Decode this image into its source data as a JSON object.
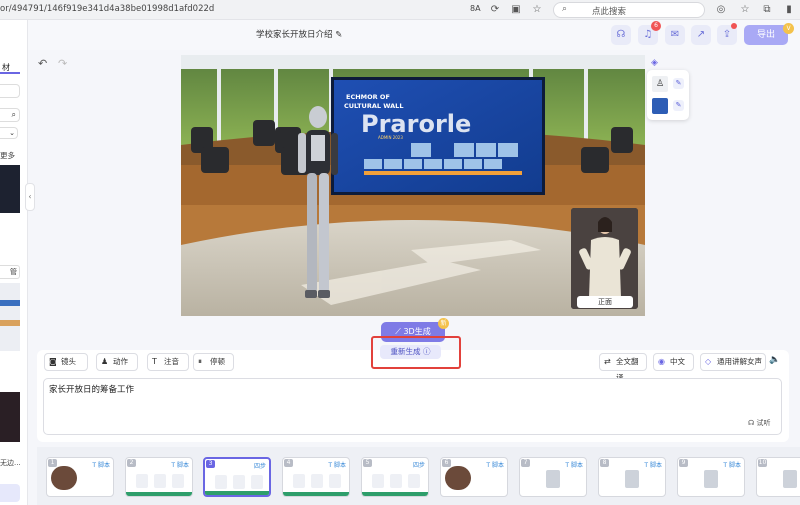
{
  "browser": {
    "url": "or/494791/146f919e341d4a38be01998d1afd022d",
    "search_placeholder": "点此搜索",
    "zoom_label": "8A",
    "icons": [
      "reader-icon",
      "refresh-icon",
      "extensions-icon",
      "favorite-icon",
      "copilot-icon",
      "collections-icon",
      "sidebar-icon"
    ]
  },
  "header": {
    "doc_title": "学校家长开放日介绍",
    "export_label": "导出",
    "notification_badge": "6"
  },
  "left_panel": {
    "visible_text": [
      "材",
      "更多",
      "管"
    ]
  },
  "stage": {
    "screen_title_line1": "ECHMOR OF",
    "screen_title_line2": "CULTURAL WALL",
    "screen_big_text": "Prarorle",
    "screen_sub": "ADMIN 2023",
    "avatar_label": "正面"
  },
  "gen3d": {
    "label": "3D生成",
    "badge": "新"
  },
  "regen": {
    "label": "重新生成"
  },
  "toolbar": {
    "camera": "镜头",
    "action": "动作",
    "note": "注音",
    "pause": "停顿",
    "translate": "全文翻译",
    "language": "中文",
    "voice": "通用讲解女声"
  },
  "script": {
    "text": "家长开放日的筹备工作",
    "listen": "试听"
  },
  "slides": [
    {
      "num": "1",
      "title": "T 脚本",
      "selected": false
    },
    {
      "num": "2",
      "title": "T 脚本",
      "selected": false
    },
    {
      "num": "3",
      "title": "四步",
      "selected": true
    },
    {
      "num": "4",
      "title": "T 脚本",
      "selected": false
    },
    {
      "num": "5",
      "title": "四步",
      "selected": false
    },
    {
      "num": "6",
      "title": "T 脚本",
      "selected": false
    },
    {
      "num": "7",
      "title": "T 脚本",
      "selected": false
    },
    {
      "num": "8",
      "title": "T 脚本",
      "selected": false
    },
    {
      "num": "9",
      "title": "T 脚本",
      "selected": false
    },
    {
      "num": "10",
      "title": "T 脚本",
      "selected": false
    }
  ],
  "colors": {
    "accent": "#6a66e3",
    "highlight_box": "#e2413b",
    "badge": "#f05454"
  }
}
